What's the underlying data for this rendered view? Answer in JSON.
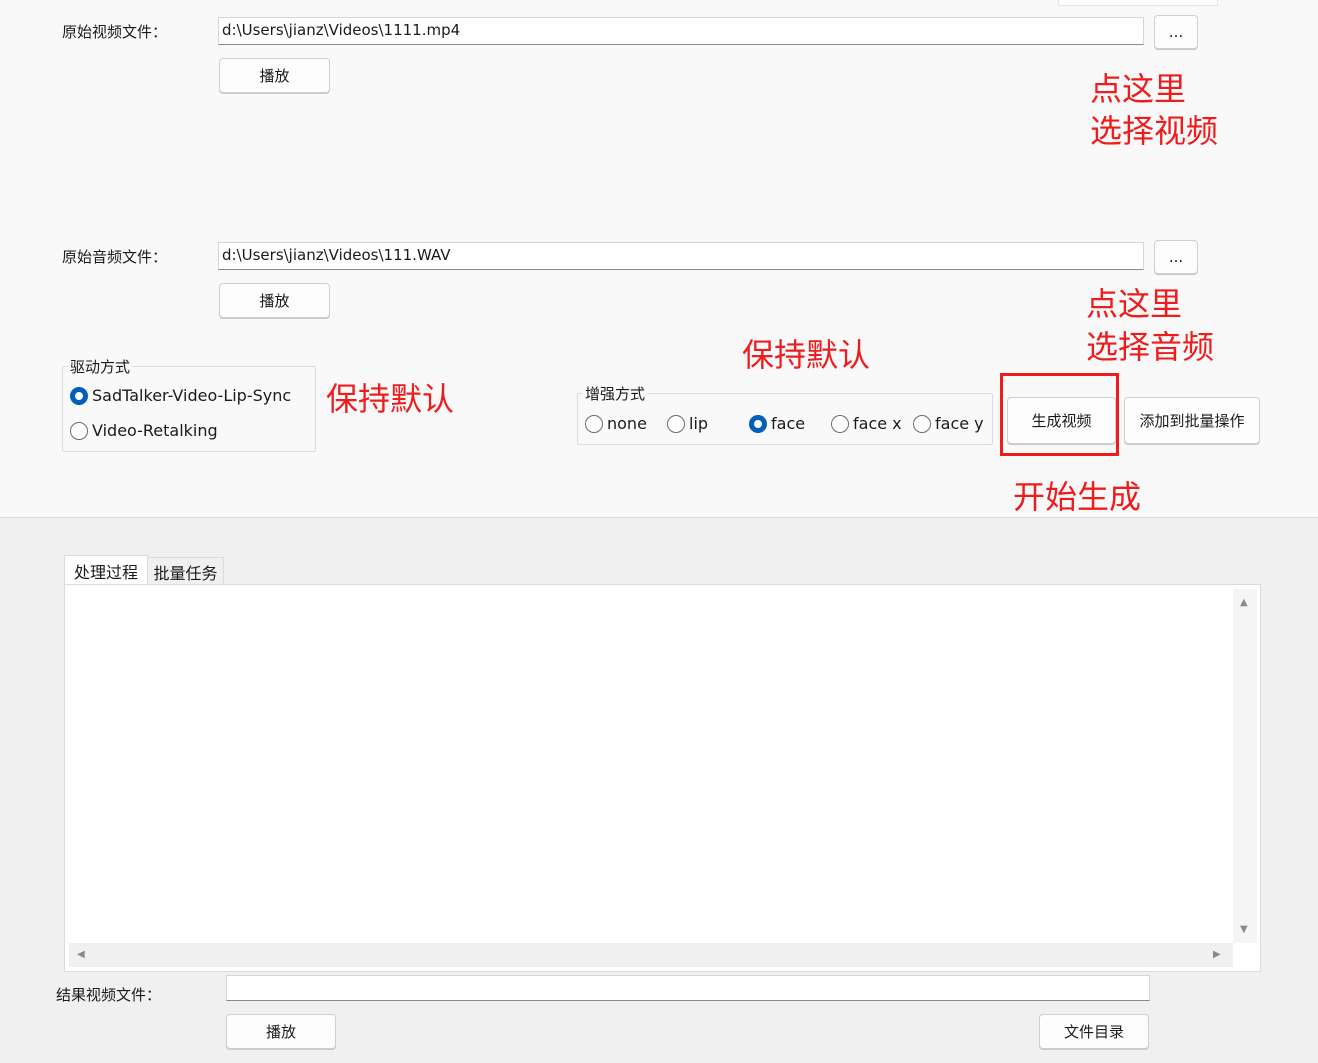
{
  "video_section": {
    "label": "原始视频文件：",
    "path": "d:\\Users\\jianz\\Videos\\1111.mp4",
    "browse_label": "...",
    "play_label": "播放"
  },
  "audio_section": {
    "label": "原始音频文件：",
    "path": "d:\\Users\\jianz\\Videos\\111.WAV",
    "browse_label": "...",
    "play_label": "播放"
  },
  "drive_mode": {
    "title": "驱动方式",
    "options": [
      {
        "label": "SadTalker-Video-Lip-Sync",
        "selected": true
      },
      {
        "label": "Video-Retalking",
        "selected": false
      }
    ]
  },
  "enhance_mode": {
    "title": "增强方式",
    "options": [
      {
        "label": "none",
        "selected": false
      },
      {
        "label": "lip",
        "selected": false
      },
      {
        "label": "face",
        "selected": true
      },
      {
        "label": "face x",
        "selected": false
      },
      {
        "label": "face y",
        "selected": false
      }
    ]
  },
  "actions": {
    "generate_label": "生成视频",
    "add_batch_label": "添加到批量操作"
  },
  "tabs": [
    {
      "label": "处理过程",
      "active": true
    },
    {
      "label": "批量任务",
      "active": false
    }
  ],
  "result_section": {
    "label": "结果视频文件：",
    "path": "",
    "play_label": "播放",
    "folder_label": "文件目录"
  },
  "annotations": {
    "select_video": [
      "点这里",
      "选择视频"
    ],
    "select_audio": [
      "点这里",
      "选择音频"
    ],
    "keep_default_drive": "保持默认",
    "keep_default_enhance": "保持默认",
    "start_generate": "开始生成",
    "color": "#ee1c1c"
  },
  "colors": {
    "accent": "#005fb8",
    "background": "#f9f9f9",
    "annotation": "#ee1c1c"
  }
}
